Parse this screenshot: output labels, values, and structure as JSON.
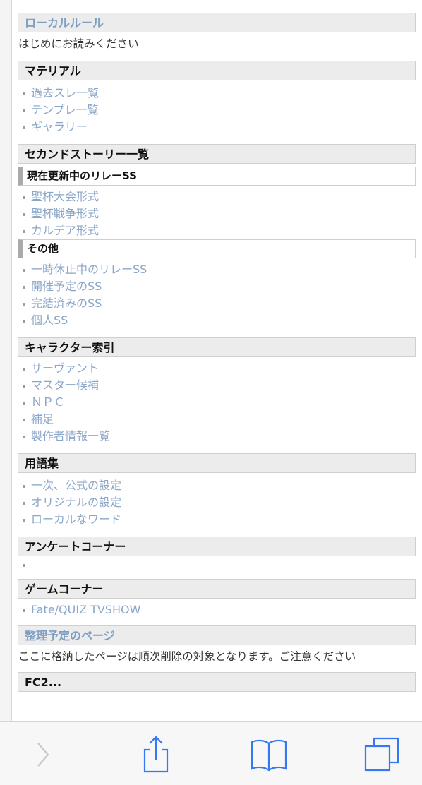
{
  "sections": {
    "local_rules": {
      "title": "ローカルルール",
      "note": "はじめにお読みください"
    },
    "material": {
      "title": "マテリアル",
      "items": [
        "過去スレ一覧",
        "テンプレ一覧",
        "ギャラリー"
      ]
    },
    "second_story": {
      "title": "セカンドストーリー一覧",
      "sub1": {
        "title": "現在更新中のリレーSS",
        "items": [
          "聖杯大会形式",
          "聖杯戦争形式",
          "カルデア形式"
        ]
      },
      "sub2": {
        "title": "その他",
        "items": [
          "一時休止中のリレーSS",
          "開催予定のSS",
          "完結済みのSS",
          "個人SS"
        ]
      }
    },
    "character_index": {
      "title": "キャラクター索引",
      "items": [
        "サーヴァント",
        "マスター候補",
        "ＮＰＣ",
        "補足",
        "製作者情報一覧"
      ]
    },
    "glossary": {
      "title": "用語集",
      "items": [
        "一次、公式の設定",
        "オリジナルの設定",
        "ローカルなワード"
      ]
    },
    "survey": {
      "title": "アンケートコーナー"
    },
    "game": {
      "title": "ゲームコーナー",
      "items": [
        "Fate/QUIZ TVSHOW"
      ]
    },
    "planned": {
      "title": "整理予定のページ",
      "note": "ここに格納したページは順次削除の対象となります。ご注意ください"
    },
    "fc2": {
      "title": "FC2..."
    }
  },
  "toolbar": {
    "icons": [
      "chevron-right-icon",
      "share-icon",
      "bookmarks-icon",
      "tabs-icon"
    ]
  },
  "colors": {
    "link": "#8aa6c8",
    "icon": "#3478f6",
    "disabled": "#c8c8c8"
  }
}
